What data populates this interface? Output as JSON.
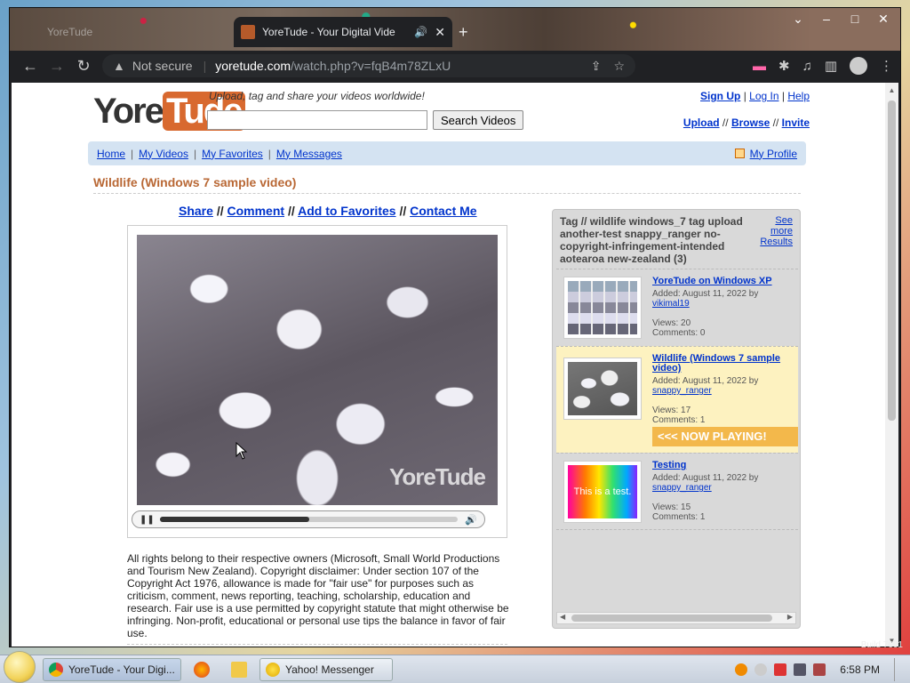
{
  "browser": {
    "inactive_tab": "YoreTude",
    "active_tab": "YoreTude - Your Digital Vide",
    "not_secure": "Not secure",
    "url_host": "yoretude.com",
    "url_path": "/watch.php?v=fqB4m78ZLxU"
  },
  "site": {
    "tagline": "Upload, tag and share your videos worldwide!",
    "search_button": "Search Videos",
    "search_value": "",
    "util_top": [
      "Sign Up",
      "Log In",
      "Help"
    ],
    "util_bot": [
      "Upload",
      "Browse",
      "Invite"
    ]
  },
  "nav": {
    "items": [
      "Home",
      "My Videos",
      "My Favorites",
      "My Messages"
    ],
    "profile": "My Profile"
  },
  "video": {
    "title": "Wildlife (Windows 7 sample video)",
    "actions": [
      "Share",
      "Comment",
      "Add to Favorites",
      "Contact Me"
    ],
    "watermark": "YoreTude",
    "progress": 0.5,
    "disclaimer": "All rights belong to their respective owners (Microsoft, Small World Productions and Tourism New Zealand). Copyright disclaimer: Under section 107 of the Copyright Act 1976, allowance is made for \"fair use\" for purposes such as criticism, comment, news reporting, teaching, scholarship, education and research. Fair use is a use permitted by copyright statute that might otherwise be infringing. Non-profit, educational or personal use tips the balance in favor of fair use."
  },
  "related": {
    "heading": "Tag // wildlife windows_7 tag upload another-test snappy_ranger no-copyright-infringement-intended aotearoa new-zealand (3)",
    "see_more": "See more Results",
    "items": [
      {
        "title": "YoreTude on Windows XP",
        "added": "Added: August 11, 2022 by",
        "user": "vikimal19",
        "views": "Views: 20",
        "comments": "Comments: 0"
      },
      {
        "title": "Wildlife (Windows 7 sample video)",
        "added": "Added: August 11, 2022 by",
        "user": "snappy_ranger",
        "views": "Views: 17",
        "comments": "Comments: 1"
      },
      {
        "title": "Testing",
        "added": "Added: August 11, 2022 by",
        "user": "snappy_ranger",
        "views": "Views: 15",
        "comments": "Comments: 1"
      }
    ],
    "now_playing": "<<< NOW PLAYING!",
    "test_thumb": "This is a test."
  },
  "taskbar": {
    "chrome_btn": "YoreTude - Your Digi...",
    "yahoo_btn": "Yahoo! Messenger",
    "time": "6:58 PM",
    "build": "Build 7601"
  }
}
